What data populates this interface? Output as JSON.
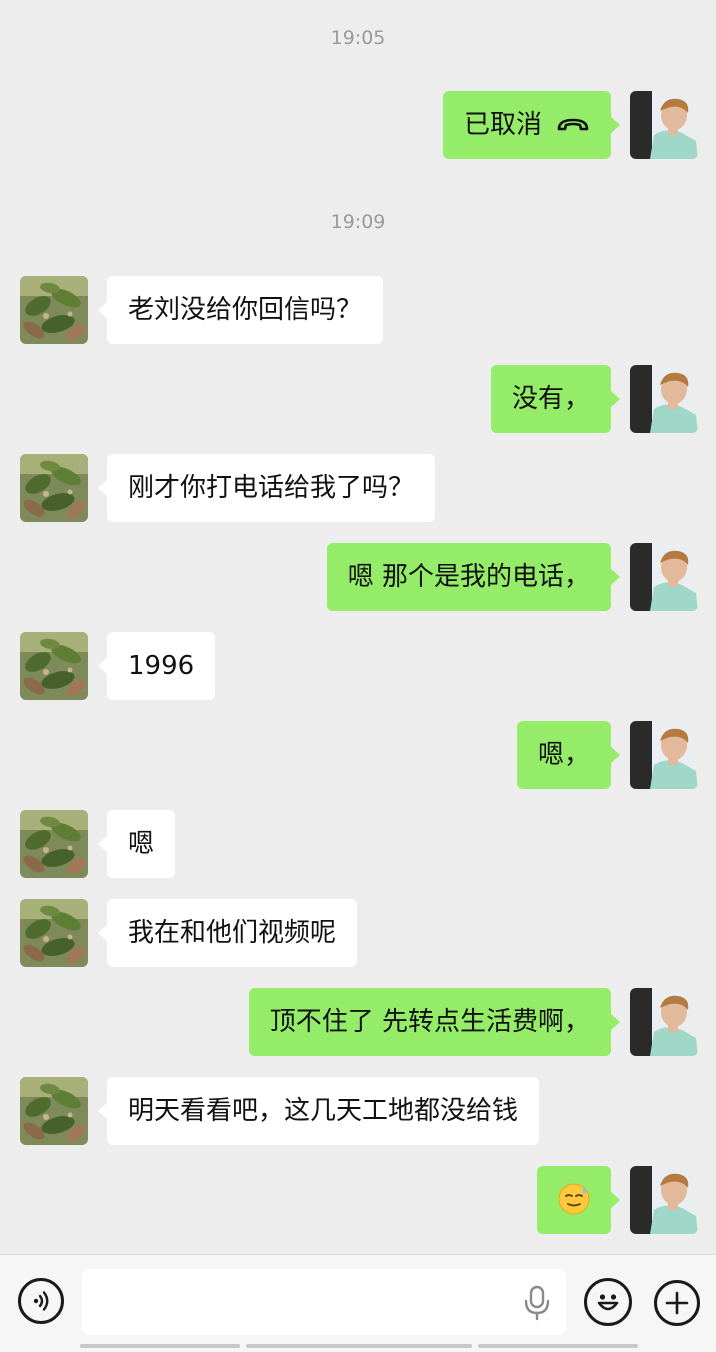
{
  "timestamps": [
    "19:05",
    "19:09"
  ],
  "messages": [
    {
      "side": "right",
      "text": "已取消",
      "icon": "hangup-icon"
    },
    {
      "side": "left",
      "text": "老刘没给你回信吗？"
    },
    {
      "side": "right",
      "text": "没有，"
    },
    {
      "side": "left",
      "text": "刚才你打电话给我了吗？"
    },
    {
      "side": "right",
      "text": "嗯 那个是我的电话，"
    },
    {
      "side": "left",
      "text": "1996"
    },
    {
      "side": "right",
      "text": "嗯，"
    },
    {
      "side": "left",
      "text": "嗯"
    },
    {
      "side": "left",
      "text": "我在和他们视频呢"
    },
    {
      "side": "right",
      "text": "顶不住了 先转点生活费啊，"
    },
    {
      "side": "left",
      "text": "明天看看吧，这几天工地都没给钱"
    },
    {
      "side": "right",
      "text": "",
      "icon": "sweat-smile-emoji"
    }
  ],
  "input": {
    "value": "",
    "placeholder": ""
  },
  "colors": {
    "background": "#ededed",
    "sent_bubble": "#95ec69",
    "received_bubble": "#ffffff",
    "timestamp": "#9a9a9a"
  },
  "icons": {
    "voice": "voice-icon",
    "mic": "mic-icon",
    "emoji": "emoji-icon",
    "plus": "plus-icon"
  }
}
